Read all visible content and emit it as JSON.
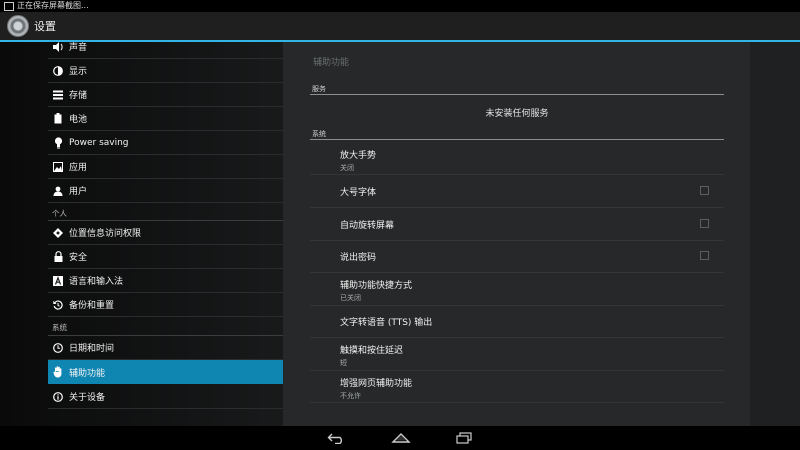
{
  "status_bar": {
    "text": "正在保存屏幕截图..."
  },
  "action_bar": {
    "title": "设置"
  },
  "left_nav": {
    "items": [
      {
        "label": "声音",
        "icon": "speaker-icon"
      },
      {
        "label": "显示",
        "icon": "brightness-icon"
      },
      {
        "label": "存储",
        "icon": "storage-icon"
      },
      {
        "label": "电池",
        "icon": "battery-icon"
      },
      {
        "label": "Power saving",
        "icon": "lightbulb-icon"
      },
      {
        "label": "应用",
        "icon": "apps-icon"
      },
      {
        "label": "用户",
        "icon": "user-icon"
      },
      {
        "label": "位置信息访问权限",
        "icon": "location-icon"
      },
      {
        "label": "安全",
        "icon": "lock-icon"
      },
      {
        "label": "语言和输入法",
        "icon": "language-icon"
      },
      {
        "label": "备份和重置",
        "icon": "backup-icon"
      },
      {
        "label": "日期和时间",
        "icon": "clock-icon"
      },
      {
        "label": "辅助功能",
        "icon": "hand-icon"
      },
      {
        "label": "关于设备",
        "icon": "info-icon"
      }
    ],
    "headers": {
      "personal": "个人",
      "system": "系统"
    },
    "selected": "辅助功能"
  },
  "main": {
    "title": "辅助功能",
    "services_header": "服务",
    "no_services": "未安装任何服务",
    "system_header": "系统",
    "items": [
      {
        "title": "放大手势",
        "subtitle": "关闭",
        "checkbox": false
      },
      {
        "title": "大号字体",
        "subtitle": "",
        "checkbox": true,
        "checked": false
      },
      {
        "title": "自动旋转屏幕",
        "subtitle": "",
        "checkbox": true,
        "checked": false
      },
      {
        "title": "说出密码",
        "subtitle": "",
        "checkbox": true,
        "checked": false
      },
      {
        "title": "辅助功能快捷方式",
        "subtitle": "已关闭",
        "checkbox": false
      },
      {
        "title": "文字转语音 (TTS) 输出",
        "subtitle": "",
        "checkbox": false
      },
      {
        "title": "触摸和按住延迟",
        "subtitle": "短",
        "checkbox": false
      },
      {
        "title": "增强网页辅助功能",
        "subtitle": "不允许",
        "checkbox": false
      }
    ]
  },
  "colors": {
    "accent": "#33b5e5",
    "selected_bg": "#0f86b2"
  },
  "nav_bar": {
    "buttons": [
      "back-icon",
      "home-icon",
      "recents-icon"
    ]
  }
}
